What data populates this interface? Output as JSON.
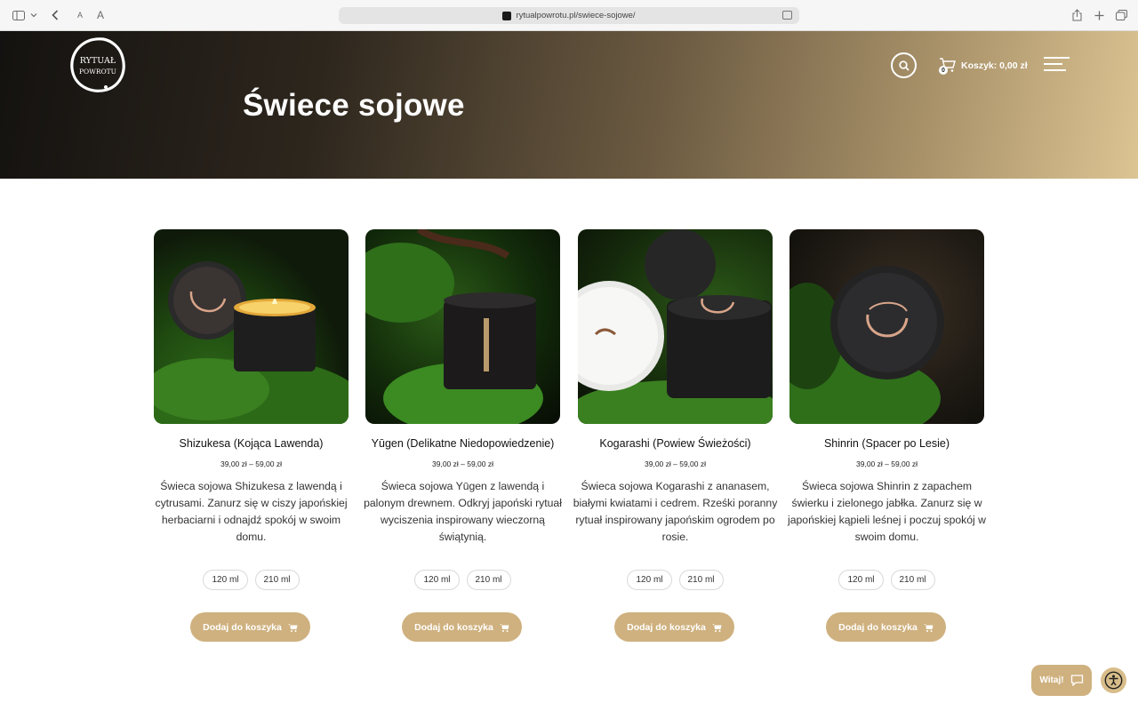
{
  "browser": {
    "url": "rytualpowrotu.pl/swiece-sojowe/",
    "font_small": "A",
    "font_large": "A"
  },
  "header": {
    "logo_text_top": "RYTUAŁ",
    "logo_text_bottom": "POWROTU",
    "title": "Świece sojowe",
    "cart_label": "Koszyk: 0,00 zł",
    "cart_count": "0",
    "icons": [
      "search-icon",
      "cart-icon",
      "hamburger-menu-icon"
    ]
  },
  "colors": {
    "accent": "#cfb17f",
    "hero_dark": "#141210",
    "hero_light": "#dcc493"
  },
  "products": [
    {
      "name": "Shizukesa (Kojąca Lawenda)",
      "price": "39,00 zł – 59,00 zł",
      "description": "Świeca sojowa Shizukesa z lawendą i cytrusami. Zanurz się w ciszy japońskiej herbaciarni i odnajdź spokój w swoim domu.",
      "variants": [
        "120 ml",
        "210 ml"
      ],
      "button": "Dodaj do koszyka"
    },
    {
      "name": "Yūgen (Delikatne Niedopowiedzenie)",
      "price": "39,00 zł – 59,00 zł",
      "description": "Świeca sojowa Yūgen z lawendą i palonym drewnem. Odkryj japoński rytuał wyciszenia inspirowany wieczorną świątynią.",
      "variants": [
        "120 ml",
        "210 ml"
      ],
      "button": "Dodaj do koszyka"
    },
    {
      "name": "Kogarashi (Powiew Świeżości)",
      "price": "39,00 zł – 59,00 zł",
      "description": "Świeca sojowa Kogarashi z ananasem, białymi kwiatami i cedrem. Rześki poranny rytuał inspirowany japońskim ogrodem po rosie.",
      "variants": [
        "120 ml",
        "210 ml"
      ],
      "button": "Dodaj do koszyka"
    },
    {
      "name": "Shinrin (Spacer po Lesie)",
      "price": "39,00 zł – 59,00 zł",
      "description": "Świeca sojowa Shinrin z zapachem świerku i zielonego jabłka. Zanurz się w japońskiej kąpieli leśnej i poczuj spokój w swoim domu.",
      "variants": [
        "120 ml",
        "210 ml"
      ],
      "button": "Dodaj do koszyka"
    }
  ],
  "chat": {
    "label": "Witaj!"
  }
}
